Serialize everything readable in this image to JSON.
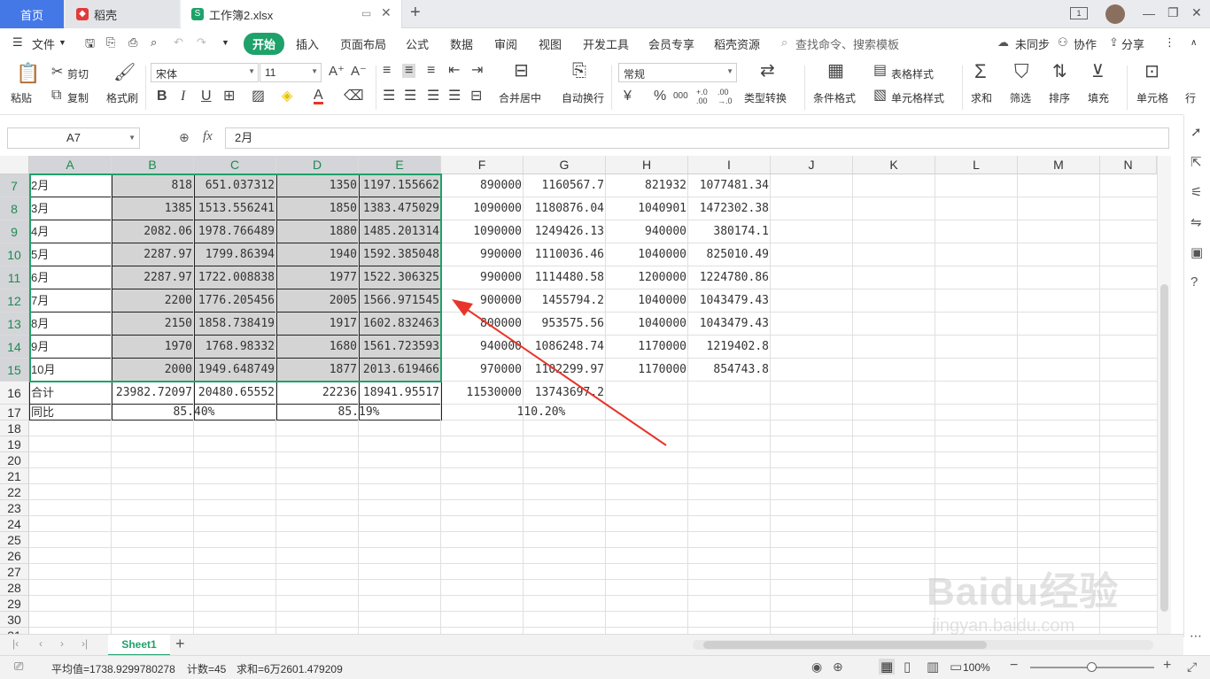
{
  "tabs": {
    "home": "首页",
    "daoke": "稻壳",
    "doc": "工作簿2.xlsx"
  },
  "menubar": {
    "file": "文件",
    "items": [
      "开始",
      "插入",
      "页面布局",
      "公式",
      "数据",
      "审阅",
      "视图",
      "开发工具",
      "会员专享",
      "稻壳资源"
    ],
    "search": "查找命令、搜索模板",
    "sync": "未同步",
    "collab": "协作",
    "share": "分享"
  },
  "ribbon": {
    "paste": "粘贴",
    "cut": "剪切",
    "copy": "复制",
    "format_painter": "格式刷",
    "font_name": "宋体",
    "font_size": "11",
    "merge_center": "合并居中",
    "wrap_text": "自动换行",
    "number_format": "常规",
    "type_convert": "类型转换",
    "conditional_format": "条件格式",
    "table_style": "表格样式",
    "cell_style": "单元格样式",
    "sum": "求和",
    "filter": "筛选",
    "sort": "排序",
    "fill": "填充",
    "cell": "单元格",
    "row_col": "行",
    "bold": "B",
    "italic": "I",
    "underline": "U",
    "font_color": "A",
    "currency": "¥",
    "percent": "%",
    "thousands": "000",
    "inc_decimal": "+.0 .00",
    "dec_decimal": ".00 →.0"
  },
  "formula": {
    "name_box": "A7",
    "fx": "fx",
    "value": "2月"
  },
  "grid": {
    "columns": [
      "A",
      "B",
      "C",
      "D",
      "E",
      "F",
      "G",
      "H",
      "I",
      "J",
      "K",
      "L",
      "M",
      "N"
    ],
    "rows": [
      {
        "n": "7",
        "cells": [
          "2月",
          "818",
          "651.037312",
          "1350",
          "1197.155662",
          "890000",
          "1160567.7",
          "821932",
          "1077481.34"
        ]
      },
      {
        "n": "8",
        "cells": [
          "3月",
          "1385",
          "1513.556241",
          "1850",
          "1383.475029",
          "1090000",
          "1180876.04",
          "1040901",
          "1472302.38"
        ]
      },
      {
        "n": "9",
        "cells": [
          "4月",
          "2082.06",
          "1978.766489",
          "1880",
          "1485.201314",
          "1090000",
          "1249426.13",
          "940000",
          "380174.1"
        ]
      },
      {
        "n": "10",
        "cells": [
          "5月",
          "2287.97",
          "1799.86394",
          "1940",
          "1592.385048",
          "990000",
          "1110036.46",
          "1040000",
          "825010.49"
        ]
      },
      {
        "n": "11",
        "cells": [
          "6月",
          "2287.97",
          "1722.008838",
          "1977",
          "1522.306325",
          "990000",
          "1114480.58",
          "1200000",
          "1224780.86"
        ]
      },
      {
        "n": "12",
        "cells": [
          "7月",
          "2200",
          "1776.205456",
          "2005",
          "1566.971545",
          "900000",
          "1455794.2",
          "1040000",
          "1043479.43"
        ]
      },
      {
        "n": "13",
        "cells": [
          "8月",
          "2150",
          "1858.738419",
          "1917",
          "1602.832463",
          "800000",
          "953575.56",
          "1040000",
          "1043479.43"
        ]
      },
      {
        "n": "14",
        "cells": [
          "9月",
          "1970",
          "1768.98332",
          "1680",
          "1561.723593",
          "940000",
          "1086248.74",
          "1170000",
          "1219402.8"
        ]
      },
      {
        "n": "15",
        "cells": [
          "10月",
          "2000",
          "1949.648749",
          "1877",
          "2013.619466",
          "970000",
          "1102299.97",
          "1170000",
          "854743.8"
        ]
      },
      {
        "n": "16",
        "cells": [
          "合计",
          "23982.72097",
          "20480.65552",
          "22236",
          "18941.95517",
          "11530000",
          "13743697.2",
          "",
          ""
        ]
      },
      {
        "n": "17",
        "cells": [
          "同比",
          "85.40%",
          "",
          "85.19%",
          "",
          "110.20%",
          "",
          "",
          ""
        ]
      }
    ],
    "empty_rows": [
      "18",
      "19",
      "20",
      "21",
      "22",
      "23",
      "24",
      "25",
      "26",
      "27",
      "28",
      "29",
      "30",
      "31"
    ]
  },
  "sheetbar": {
    "sheet_name": "Sheet1",
    "add": "+"
  },
  "statusbar": {
    "average": "平均值=1738.9299780278",
    "count": "计数=45",
    "sum": "求和=6万2601.479209",
    "zoom": "100%"
  },
  "watermark": {
    "logo": "Baidu经验",
    "url": "jingyan.baidu.com"
  },
  "colors": {
    "accent": "#1fa16b",
    "tab_home": "#4478e7",
    "selection": "#d4d4d4",
    "arrow": "#e8352b"
  }
}
